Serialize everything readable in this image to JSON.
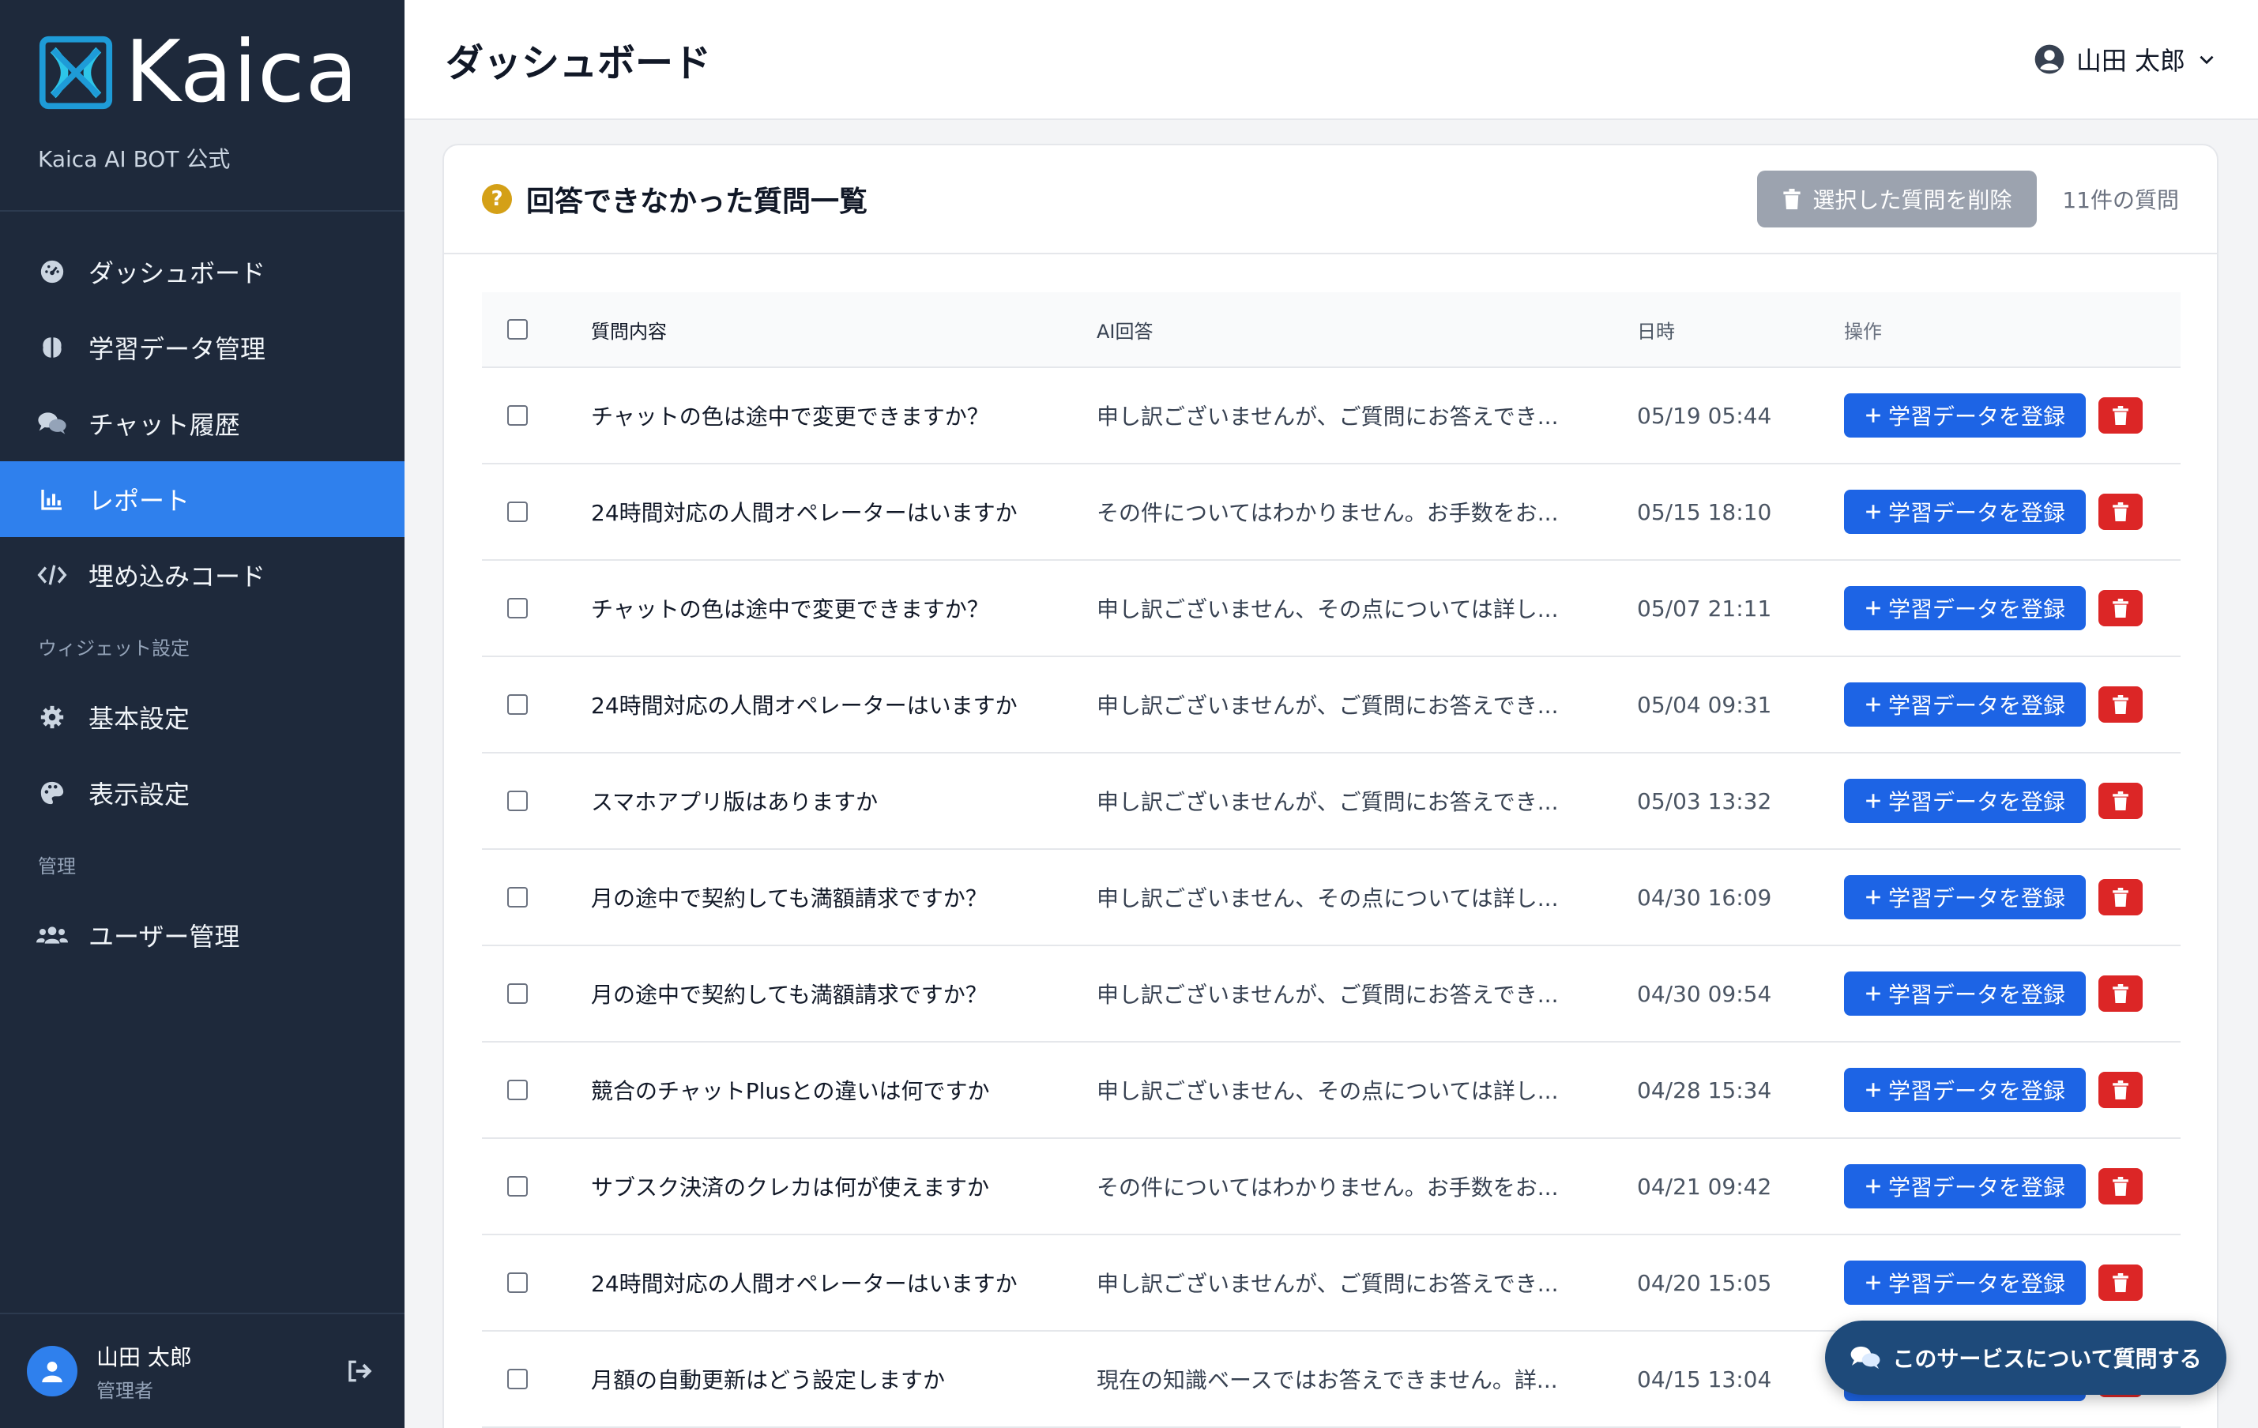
{
  "brand": {
    "name": "Kaica",
    "subtitle": "Kaica AI BOT 公式"
  },
  "sidebar": {
    "items": [
      {
        "label": "ダッシュボード",
        "icon": "gauge-icon"
      },
      {
        "label": "学習データ管理",
        "icon": "brain-icon"
      },
      {
        "label": "チャット履歴",
        "icon": "comments-icon"
      },
      {
        "label": "レポート",
        "icon": "chart-icon",
        "active": true
      },
      {
        "label": "埋め込みコード",
        "icon": "code-icon"
      }
    ],
    "section_widget": "ウィジェット設定",
    "widget_items": [
      {
        "label": "基本設定",
        "icon": "gear-icon"
      },
      {
        "label": "表示設定",
        "icon": "palette-icon"
      }
    ],
    "section_admin": "管理",
    "admin_items": [
      {
        "label": "ユーザー管理",
        "icon": "users-icon"
      }
    ],
    "footer": {
      "name": "山田 太郎",
      "role": "管理者"
    }
  },
  "header": {
    "title": "ダッシュボード",
    "user": "山田 太郎"
  },
  "card": {
    "title": "回答できなかった質問一覧",
    "delete_label": "選択した質問を削除",
    "count_label": "11件の質問"
  },
  "table": {
    "columns": [
      "質問内容",
      "AI回答",
      "日時",
      "操作"
    ],
    "register_label": "学習データを登録",
    "rows": [
      {
        "q": "チャットの色は途中で変更できますか？",
        "a": "申し訳ございませんが、ご質問にお答えでき...",
        "d": "05/19 05:44"
      },
      {
        "q": "24時間対応の人間オペレーターはいますか",
        "a": "その件についてはわかりません。お手数をお...",
        "d": "05/15 18:10"
      },
      {
        "q": "チャットの色は途中で変更できますか？",
        "a": "申し訳ございません、その点については詳し...",
        "d": "05/07 21:11"
      },
      {
        "q": "24時間対応の人間オペレーターはいますか",
        "a": "申し訳ございませんが、ご質問にお答えでき...",
        "d": "05/04 09:31"
      },
      {
        "q": "スマホアプリ版はありますか",
        "a": "申し訳ございませんが、ご質問にお答えでき...",
        "d": "05/03 13:32"
      },
      {
        "q": "月の途中で契約しても満額請求ですか？",
        "a": "申し訳ございません、その点については詳し...",
        "d": "04/30 16:09"
      },
      {
        "q": "月の途中で契約しても満額請求ですか？",
        "a": "申し訳ございませんが、ご質問にお答えでき...",
        "d": "04/30 09:54"
      },
      {
        "q": "競合のチャットPlusとの違いは何ですか",
        "a": "申し訳ございません、その点については詳し...",
        "d": "04/28 15:34"
      },
      {
        "q": "サブスク決済のクレカは何が使えますか",
        "a": "その件についてはわかりません。お手数をお...",
        "d": "04/21 09:42"
      },
      {
        "q": "24時間対応の人間オペレーターはいますか",
        "a": "申し訳ございませんが、ご質問にお答えでき...",
        "d": "04/20 15:05"
      },
      {
        "q": "月額の自動更新はどう設定しますか",
        "a": "現在の知識ベースではお答えできません。詳...",
        "d": "04/15 13:04"
      }
    ]
  },
  "help": {
    "label": "このサービスについて質問する"
  },
  "colors": {
    "sidebar_bg": "#1e293b",
    "active": "#2f80ed",
    "primary": "#1d64e5",
    "danger": "#dc2626",
    "help": "#1e4a7a"
  }
}
